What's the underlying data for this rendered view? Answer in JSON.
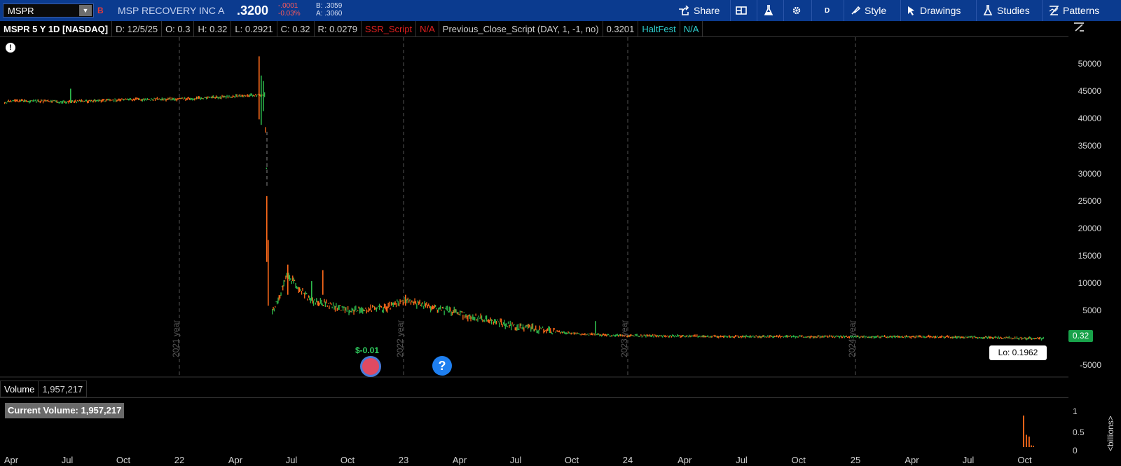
{
  "toolbar": {
    "symbol": "MSPR",
    "badge": "B",
    "company": "MSP RECOVERY INC A",
    "last": ".3200",
    "change": "-.0001",
    "change_pct": "-0.03%",
    "bid": "B: .3059",
    "ask": "A: .3060",
    "share_label": "Share",
    "aggregation": "D",
    "style_label": "Style",
    "drawings_label": "Drawings",
    "studies_label": "Studies",
    "patterns_label": "Patterns",
    "accent_color": "#0b3b8f"
  },
  "infobar": {
    "title": "MSPR 5 Y 1D [NASDAQ]",
    "date": "D: 12/5/25",
    "open": "O: 0.3",
    "high": "H: 0.32",
    "low": "L: 0.2921",
    "close": "C: 0.32",
    "range": "R: 0.0279",
    "ssr": "SSR_Script",
    "ssr_value": "N/A",
    "prev_close_study": "Previous_Close_Script (DAY, 1, -1, no)",
    "prev_close_value": "0.3201",
    "haltfest": "HaltFest",
    "haltfest_value": "N/A"
  },
  "chart": {
    "price_ticks": [
      "50000",
      "45000",
      "40000",
      "35000",
      "30000",
      "25000",
      "20000",
      "15000",
      "10000",
      "5000",
      "-5000"
    ],
    "last_price_tag": "0.32",
    "lo_label": "Lo: 0.1962",
    "dividend_label": "$-0.01",
    "dividend_icon": "dividend-event-icon",
    "event_icon": "question-icon",
    "year_labels": [
      "2021 year",
      "2022 year",
      "2023 year",
      "2024 year"
    ],
    "up_color": "#2db84b",
    "down_color": "#ff6a1a"
  },
  "chart_data": {
    "type": "line",
    "title": "",
    "xlabel": "",
    "ylabel": "",
    "x": [
      "2021-01",
      "2021-04",
      "2021-07",
      "2021-10",
      "2022-01",
      "2022-03",
      "2022-05",
      "2022-05",
      "2022-06",
      "2022-07",
      "2022-08",
      "2022-09",
      "2022-10",
      "2022-12",
      "2023-01",
      "2023-04",
      "2023-07",
      "2023-10",
      "2023-12",
      "2024-06",
      "2024-12",
      "2025-06",
      "2025-12"
    ],
    "series": [
      {
        "values": [
          43000,
          43400,
          43200,
          43600,
          43700,
          44000,
          44500,
          25000,
          4800,
          11500,
          7000,
          6200,
          5200,
          5500,
          7000,
          4500,
          2200,
          900,
          600,
          400,
          350,
          330,
          0.32
        ]
      }
    ],
    "ylim": [
      -7000,
      55000
    ],
    "grid": false
  },
  "volume": {
    "label": "Volume",
    "value": "1,957,217",
    "current_label": "Current Volume: 1,957,217",
    "ticks": [
      "1",
      "0.5",
      "0"
    ],
    "unit": "<billions>"
  },
  "time_axis": [
    "Apr",
    "Jul",
    "Oct",
    "22",
    "Apr",
    "Jul",
    "Oct",
    "23",
    "Apr",
    "Jul",
    "Oct",
    "24",
    "Apr",
    "Jul",
    "Oct",
    "25",
    "Apr",
    "Jul",
    "Oct"
  ]
}
